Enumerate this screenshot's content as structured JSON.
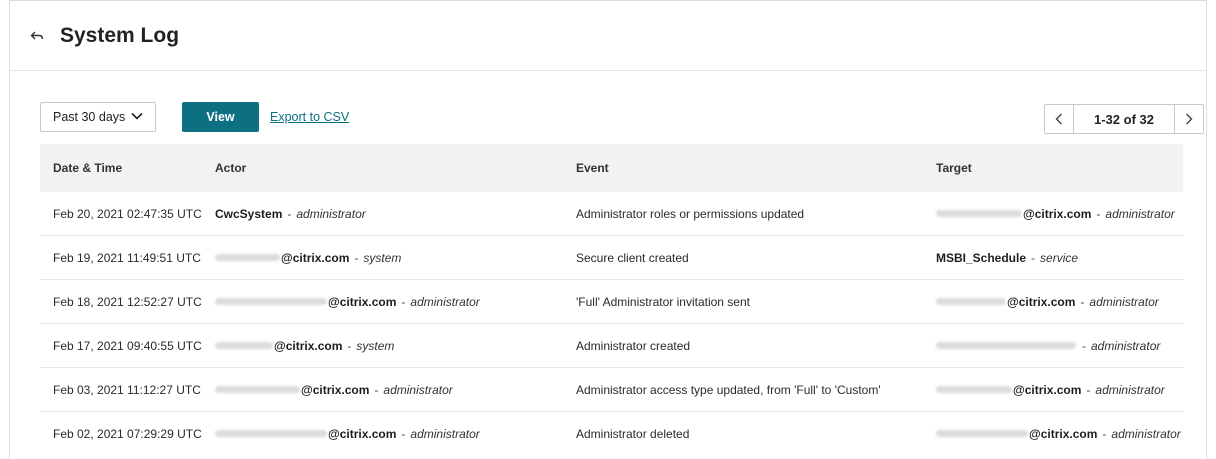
{
  "header": {
    "title": "System Log",
    "back_icon": "back-arrow-icon"
  },
  "toolbar": {
    "range_value": "Past 30 days",
    "view_label": "View",
    "export_label": "Export to CSV",
    "pagination": "1-32 of 32"
  },
  "columns": [
    "Date & Time",
    "Actor",
    "Event",
    "Target"
  ],
  "rows": [
    {
      "datetime": "Feb 20, 2021 02:47:35 UTC",
      "actor_name": "CwcSystem",
      "actor_role": "administrator",
      "event": "Administrator roles or permissions updated",
      "target_name": "@citrix.com",
      "target_role": "administrator"
    },
    {
      "datetime": "Feb 19, 2021 11:49:51 UTC",
      "actor_name": "@citrix.com",
      "actor_role": "system",
      "event": "Secure client created",
      "target_name": "MSBI_Schedule",
      "target_role": "service"
    },
    {
      "datetime": "Feb 18, 2021 12:52:27 UTC",
      "actor_name": "@citrix.com",
      "actor_role": "administrator",
      "event": "'Full' Administrator invitation sent",
      "target_name": "@citrix.com",
      "target_role": "administrator"
    },
    {
      "datetime": "Feb 17, 2021 09:40:55 UTC",
      "actor_name": "@citrix.com",
      "actor_role": "system",
      "event": "Administrator created",
      "target_name": "",
      "target_role": "administrator"
    },
    {
      "datetime": "Feb 03, 2021 11:12:27 UTC",
      "actor_name": "@citrix.com",
      "actor_role": "administrator",
      "event": "Administrator access type updated, from 'Full' to 'Custom'",
      "target_name": "@citrix.com",
      "target_role": "administrator"
    },
    {
      "datetime": "Feb 02, 2021 07:29:29 UTC",
      "actor_name": "@citrix.com",
      "actor_role": "administrator",
      "event": "Administrator deleted",
      "target_name": "@citrix.com",
      "target_role": "administrator"
    }
  ]
}
